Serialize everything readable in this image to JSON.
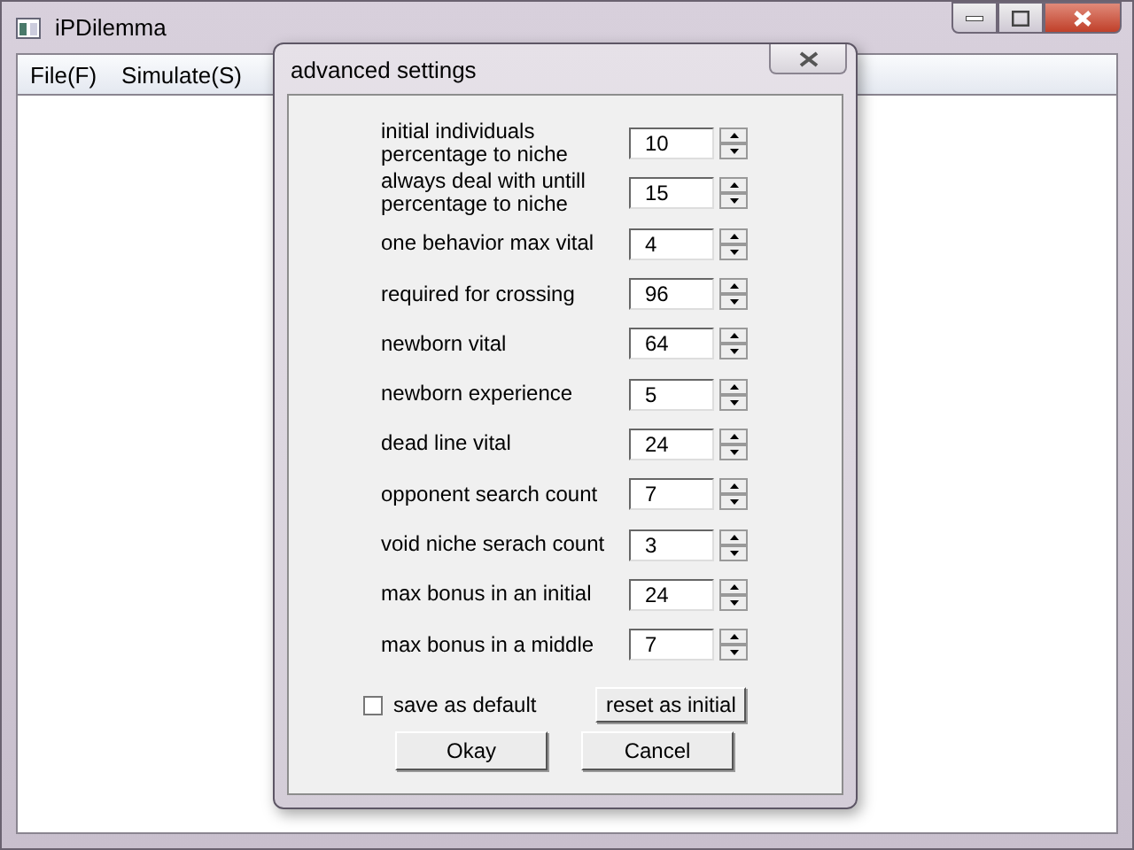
{
  "window": {
    "title": "iPDilemma"
  },
  "menu": [
    "File(F)",
    "Simulate(S)"
  ],
  "dialog": {
    "title": "advanced settings",
    "fields": [
      {
        "label": "initial individuals\npercentage to niche",
        "value": "10"
      },
      {
        "label": "always deal with untill\npercentage to niche",
        "value": "15"
      },
      {
        "label": "one behavior max vital",
        "value": "4"
      },
      {
        "label": "required for crossing",
        "value": "96"
      },
      {
        "label": "newborn vital",
        "value": "64"
      },
      {
        "label": "newborn experience",
        "value": "5"
      },
      {
        "label": "dead line vital",
        "value": "24"
      },
      {
        "label": "opponent search count",
        "value": "7"
      },
      {
        "label": "void niche serach count",
        "value": "3"
      },
      {
        "label": "max bonus in an initial",
        "value": "24"
      },
      {
        "label": "max bonus in a middle",
        "value": "7"
      }
    ],
    "save_default": {
      "label": "save as default",
      "checked": false
    },
    "reset_button": "reset as initial",
    "buttons": [
      "Okay",
      "Cancel"
    ]
  }
}
